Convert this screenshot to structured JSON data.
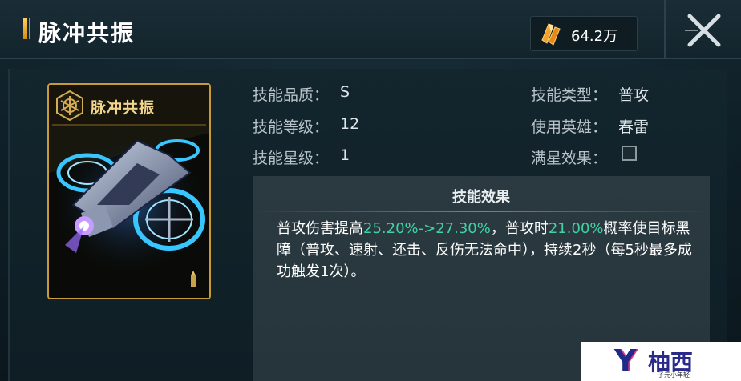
{
  "header": {
    "title": "脉冲共振",
    "currency_value": "64.2万",
    "currency_icon": "crystal-icon",
    "close_icon": "close-icon"
  },
  "card": {
    "title": "脉冲共振",
    "emblem_icon": "hexagon-emblem-icon",
    "art": "drone-illustration",
    "corner_icon": "bullet-icon",
    "frame_color": "#c89b38"
  },
  "info": {
    "quality_label": "技能品质：",
    "quality_value": "S",
    "level_label": "技能等级：",
    "level_value": "12",
    "star_label": "技能星级：",
    "star_value": "1",
    "type_label": "技能类型：",
    "type_value": "普攻",
    "hero_label": "使用英雄：",
    "hero_value": "春雷",
    "maxstar_label": "满星效果：",
    "maxstar_checked": false
  },
  "effect": {
    "title": "技能效果",
    "t1": "普攻伤害提高",
    "h1": "25.20%->27.30%",
    "t2": "，普攻时",
    "h2": "21.00%",
    "t3": "概率使目标黑障（普攻、速射、还击、反伤无法命中），持续2秒（每5秒最多成功触发1次）。",
    "highlight_color": "#3fd3a4"
  },
  "watermark": {
    "logo": "Y",
    "name": "柚西",
    "sub": "子元小年轻"
  }
}
